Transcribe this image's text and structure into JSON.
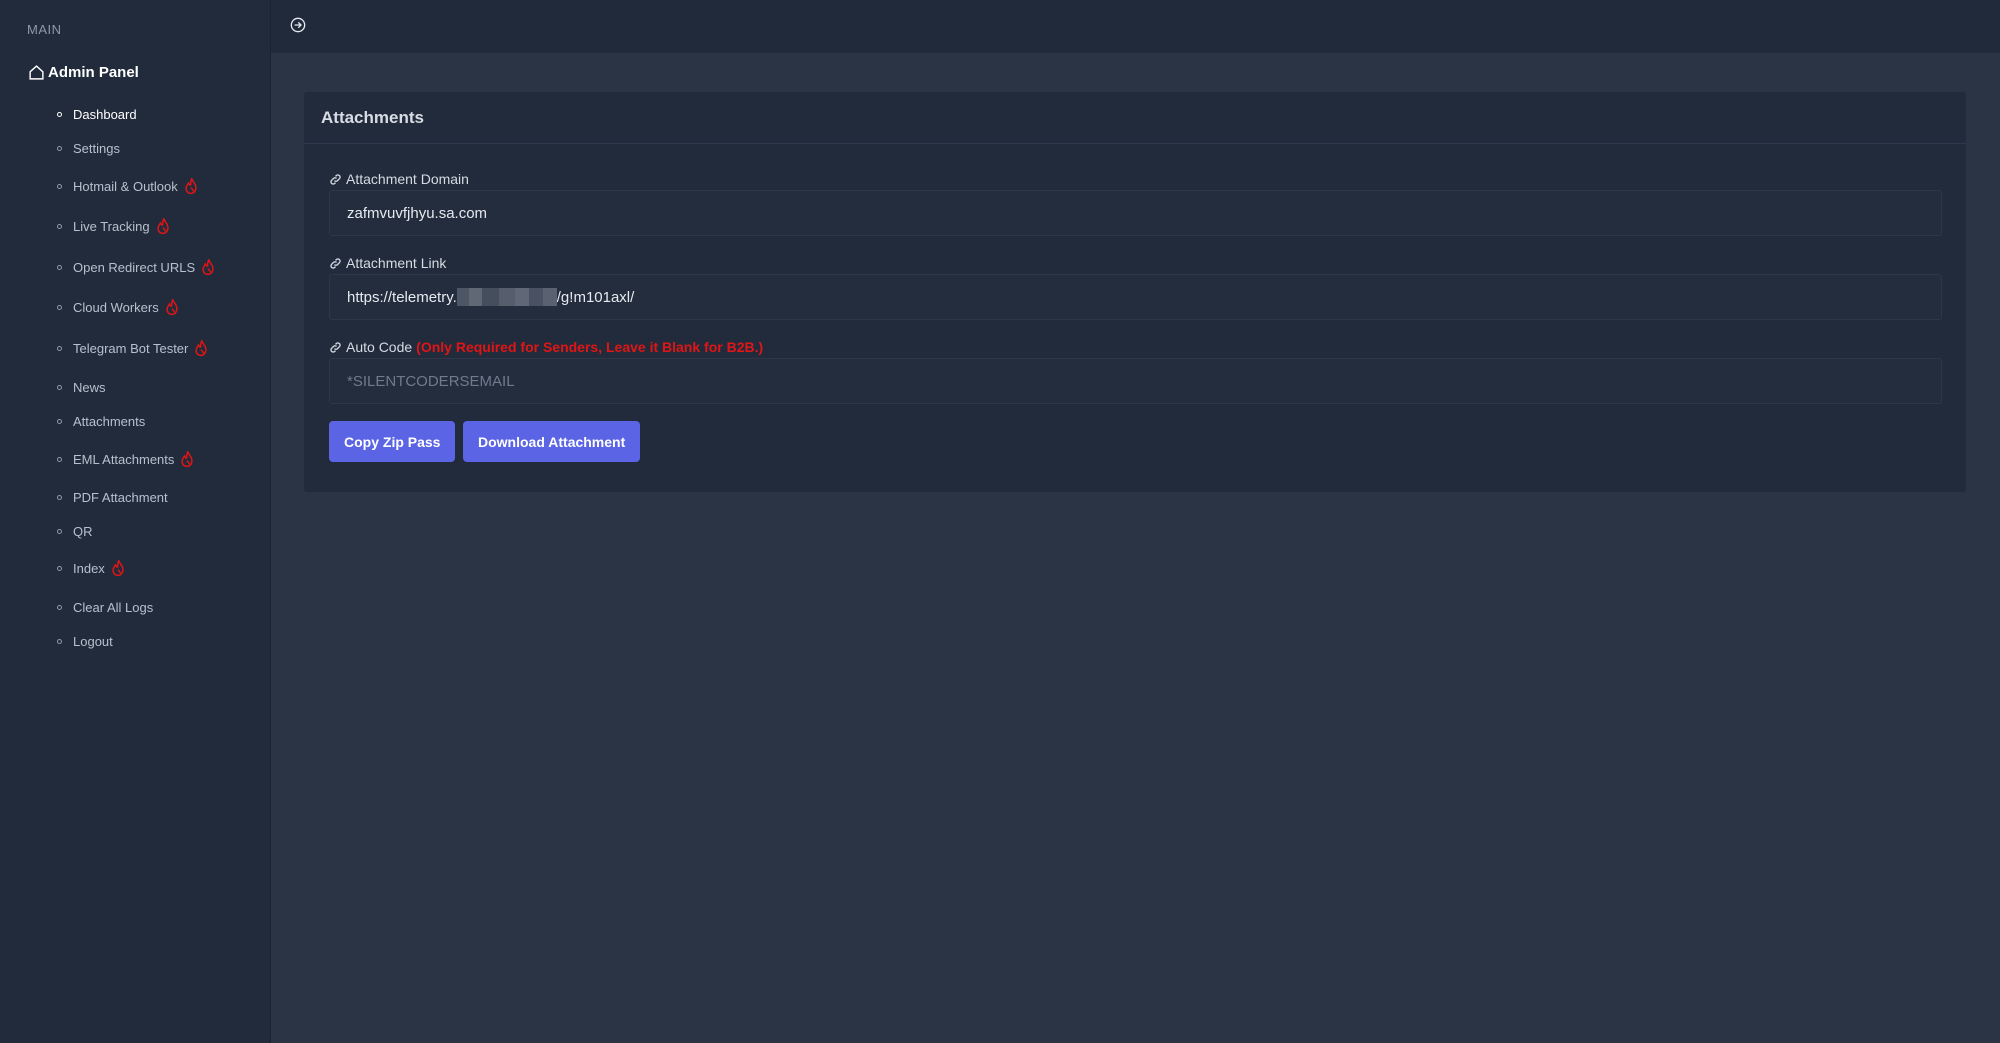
{
  "sidebar": {
    "section_label": "MAIN",
    "panel_title": "Admin Panel",
    "items": [
      {
        "label": "Dashboard",
        "hot": false,
        "active": true
      },
      {
        "label": "Settings",
        "hot": false
      },
      {
        "label": "Hotmail & Outlook",
        "hot": true
      },
      {
        "label": "Live Tracking",
        "hot": true
      },
      {
        "label": "Open Redirect URLS",
        "hot": true
      },
      {
        "label": "Cloud Workers",
        "hot": true
      },
      {
        "label": "Telegram Bot Tester",
        "hot": true
      },
      {
        "label": "News",
        "hot": false
      },
      {
        "label": "Attachments",
        "hot": false
      },
      {
        "label": "EML Attachments",
        "hot": true
      },
      {
        "label": "PDF Attachment",
        "hot": false
      },
      {
        "label": "QR",
        "hot": false
      },
      {
        "label": "Index",
        "hot": true
      },
      {
        "label": "Clear All Logs",
        "hot": false
      },
      {
        "label": "Logout",
        "hot": false
      }
    ]
  },
  "card": {
    "title": "Attachments",
    "domain_label": "Attachment Domain",
    "domain_value": "zafmvuvfjhyu.sa.com",
    "link_label": "Attachment Link",
    "link_prefix": "https://telemetry.",
    "link_suffix": "/g!m101axl/",
    "autocode_label": "Auto Code",
    "autocode_note": "(Only Required for Senders, Leave it Blank for B2B.)",
    "autocode_placeholder": "*SILENTCODERSEMAIL",
    "copy_button": "Copy Zip Pass",
    "download_button": "Download Attachment"
  },
  "colors": {
    "accent": "#5a64e4",
    "hot_icon": "#e01515",
    "note_red": "#e01515"
  },
  "icons": {
    "panel": "home-icon",
    "toggle": "arrow-circle-right-icon",
    "label": "link-icon",
    "hot": "fire-icon"
  }
}
